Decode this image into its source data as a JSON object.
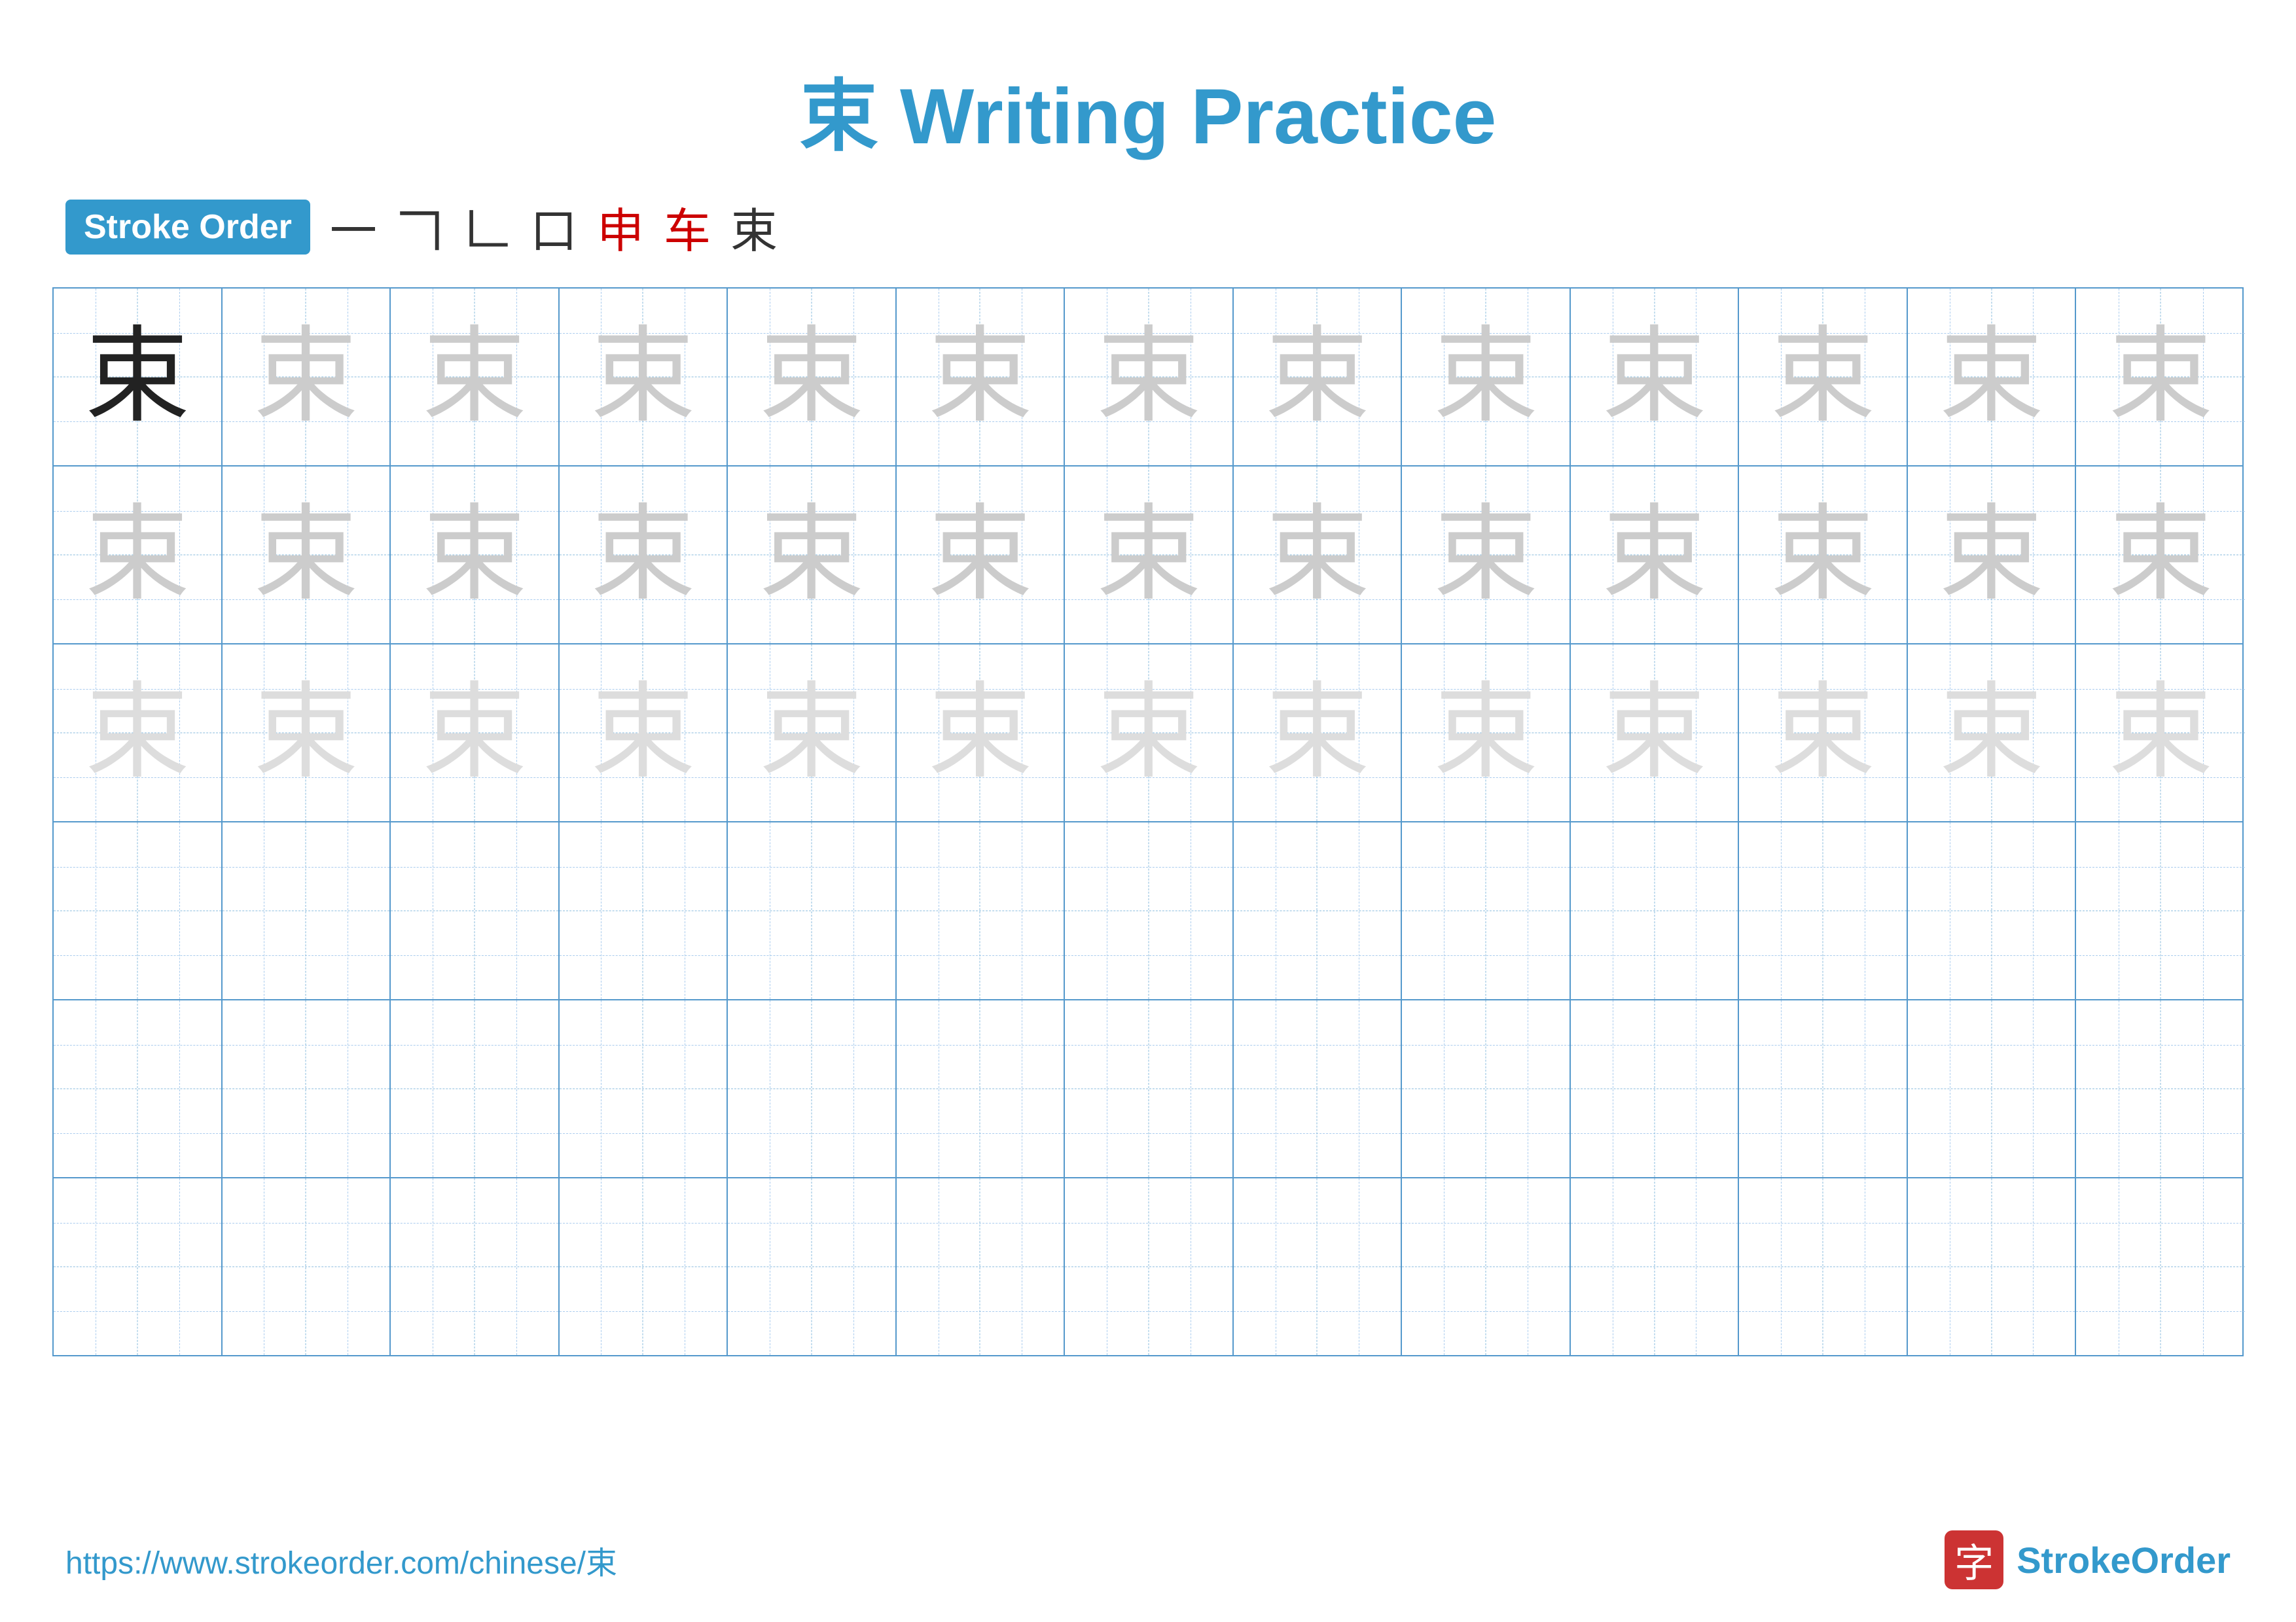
{
  "title": {
    "char": "束",
    "text": " Writing Practice"
  },
  "stroke_order": {
    "badge_label": "Stroke Order",
    "steps": [
      {
        "char": "一",
        "highlight": false
      },
      {
        "char": "𠃍",
        "highlight": false
      },
      {
        "char": "𠃊",
        "highlight": false
      },
      {
        "char": "口",
        "highlight": false
      },
      {
        "char": "申",
        "highlight": true
      },
      {
        "char": "车",
        "highlight": true
      },
      {
        "char": "束",
        "highlight": false
      }
    ]
  },
  "grid": {
    "rows": 6,
    "cols": 13,
    "char": "束",
    "row_styles": [
      [
        "dark",
        "medium",
        "medium",
        "medium",
        "medium",
        "medium",
        "medium",
        "medium",
        "medium",
        "medium",
        "medium",
        "medium",
        "medium"
      ],
      [
        "medium",
        "medium",
        "medium",
        "medium",
        "medium",
        "medium",
        "medium",
        "medium",
        "medium",
        "medium",
        "medium",
        "medium",
        "medium"
      ],
      [
        "light",
        "light",
        "light",
        "light",
        "light",
        "light",
        "light",
        "light",
        "light",
        "light",
        "light",
        "light",
        "light"
      ],
      [
        "empty",
        "empty",
        "empty",
        "empty",
        "empty",
        "empty",
        "empty",
        "empty",
        "empty",
        "empty",
        "empty",
        "empty",
        "empty"
      ],
      [
        "empty",
        "empty",
        "empty",
        "empty",
        "empty",
        "empty",
        "empty",
        "empty",
        "empty",
        "empty",
        "empty",
        "empty",
        "empty"
      ],
      [
        "empty",
        "empty",
        "empty",
        "empty",
        "empty",
        "empty",
        "empty",
        "empty",
        "empty",
        "empty",
        "empty",
        "empty",
        "empty"
      ]
    ]
  },
  "footer": {
    "url": "https://www.strokeorder.com/chinese/束",
    "logo_char": "字",
    "logo_text_part1": "Stroke",
    "logo_text_part2": "Order"
  }
}
